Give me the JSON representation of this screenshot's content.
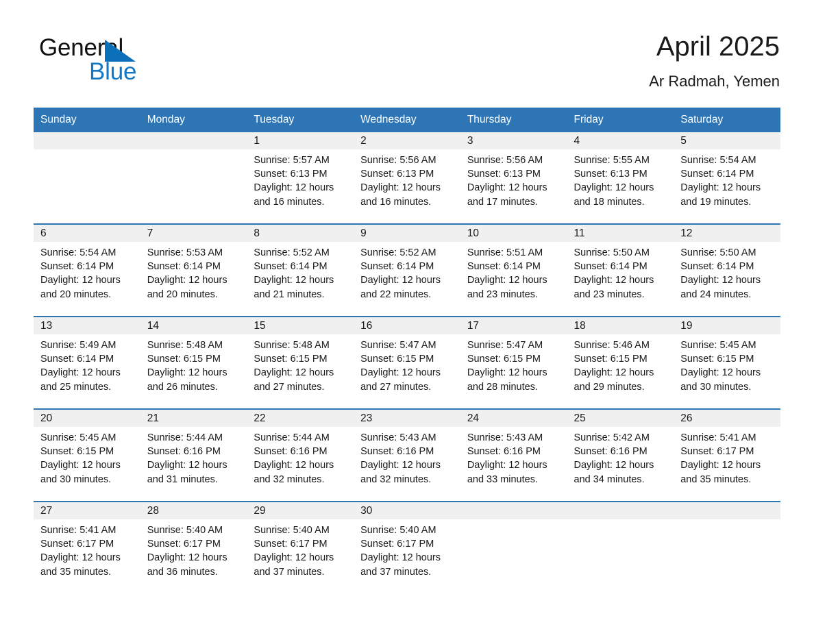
{
  "brand": {
    "word_top": "General",
    "word_bottom": "Blue",
    "triangle_color": "#0b6fba",
    "blue_color": "#1277c4"
  },
  "header": {
    "title": "April 2025",
    "subtitle": "Ar Radmah, Yemen"
  },
  "theme": {
    "header_blue": "#2e75b6",
    "daynum_band": "#f0f0f0",
    "text": "#1a1a1a"
  },
  "weekdays": [
    "Sunday",
    "Monday",
    "Tuesday",
    "Wednesday",
    "Thursday",
    "Friday",
    "Saturday"
  ],
  "labels": {
    "sunrise_prefix": "Sunrise:",
    "sunset_prefix": "Sunset:",
    "daylight_prefix": "Daylight:"
  },
  "weeks": [
    [
      {
        "day": "",
        "empty": true,
        "sunrise": "",
        "sunset": "",
        "daylight_a": "",
        "daylight_b": ""
      },
      {
        "day": "",
        "empty": true,
        "sunrise": "",
        "sunset": "",
        "daylight_a": "",
        "daylight_b": ""
      },
      {
        "day": "1",
        "empty": false,
        "sunrise": "Sunrise: 5:57 AM",
        "sunset": "Sunset: 6:13 PM",
        "daylight_a": "Daylight: 12 hours",
        "daylight_b": "and 16 minutes."
      },
      {
        "day": "2",
        "empty": false,
        "sunrise": "Sunrise: 5:56 AM",
        "sunset": "Sunset: 6:13 PM",
        "daylight_a": "Daylight: 12 hours",
        "daylight_b": "and 16 minutes."
      },
      {
        "day": "3",
        "empty": false,
        "sunrise": "Sunrise: 5:56 AM",
        "sunset": "Sunset: 6:13 PM",
        "daylight_a": "Daylight: 12 hours",
        "daylight_b": "and 17 minutes."
      },
      {
        "day": "4",
        "empty": false,
        "sunrise": "Sunrise: 5:55 AM",
        "sunset": "Sunset: 6:13 PM",
        "daylight_a": "Daylight: 12 hours",
        "daylight_b": "and 18 minutes."
      },
      {
        "day": "5",
        "empty": false,
        "sunrise": "Sunrise: 5:54 AM",
        "sunset": "Sunset: 6:14 PM",
        "daylight_a": "Daylight: 12 hours",
        "daylight_b": "and 19 minutes."
      }
    ],
    [
      {
        "day": "6",
        "empty": false,
        "sunrise": "Sunrise: 5:54 AM",
        "sunset": "Sunset: 6:14 PM",
        "daylight_a": "Daylight: 12 hours",
        "daylight_b": "and 20 minutes."
      },
      {
        "day": "7",
        "empty": false,
        "sunrise": "Sunrise: 5:53 AM",
        "sunset": "Sunset: 6:14 PM",
        "daylight_a": "Daylight: 12 hours",
        "daylight_b": "and 20 minutes."
      },
      {
        "day": "8",
        "empty": false,
        "sunrise": "Sunrise: 5:52 AM",
        "sunset": "Sunset: 6:14 PM",
        "daylight_a": "Daylight: 12 hours",
        "daylight_b": "and 21 minutes."
      },
      {
        "day": "9",
        "empty": false,
        "sunrise": "Sunrise: 5:52 AM",
        "sunset": "Sunset: 6:14 PM",
        "daylight_a": "Daylight: 12 hours",
        "daylight_b": "and 22 minutes."
      },
      {
        "day": "10",
        "empty": false,
        "sunrise": "Sunrise: 5:51 AM",
        "sunset": "Sunset: 6:14 PM",
        "daylight_a": "Daylight: 12 hours",
        "daylight_b": "and 23 minutes."
      },
      {
        "day": "11",
        "empty": false,
        "sunrise": "Sunrise: 5:50 AM",
        "sunset": "Sunset: 6:14 PM",
        "daylight_a": "Daylight: 12 hours",
        "daylight_b": "and 23 minutes."
      },
      {
        "day": "12",
        "empty": false,
        "sunrise": "Sunrise: 5:50 AM",
        "sunset": "Sunset: 6:14 PM",
        "daylight_a": "Daylight: 12 hours",
        "daylight_b": "and 24 minutes."
      }
    ],
    [
      {
        "day": "13",
        "empty": false,
        "sunrise": "Sunrise: 5:49 AM",
        "sunset": "Sunset: 6:14 PM",
        "daylight_a": "Daylight: 12 hours",
        "daylight_b": "and 25 minutes."
      },
      {
        "day": "14",
        "empty": false,
        "sunrise": "Sunrise: 5:48 AM",
        "sunset": "Sunset: 6:15 PM",
        "daylight_a": "Daylight: 12 hours",
        "daylight_b": "and 26 minutes."
      },
      {
        "day": "15",
        "empty": false,
        "sunrise": "Sunrise: 5:48 AM",
        "sunset": "Sunset: 6:15 PM",
        "daylight_a": "Daylight: 12 hours",
        "daylight_b": "and 27 minutes."
      },
      {
        "day": "16",
        "empty": false,
        "sunrise": "Sunrise: 5:47 AM",
        "sunset": "Sunset: 6:15 PM",
        "daylight_a": "Daylight: 12 hours",
        "daylight_b": "and 27 minutes."
      },
      {
        "day": "17",
        "empty": false,
        "sunrise": "Sunrise: 5:47 AM",
        "sunset": "Sunset: 6:15 PM",
        "daylight_a": "Daylight: 12 hours",
        "daylight_b": "and 28 minutes."
      },
      {
        "day": "18",
        "empty": false,
        "sunrise": "Sunrise: 5:46 AM",
        "sunset": "Sunset: 6:15 PM",
        "daylight_a": "Daylight: 12 hours",
        "daylight_b": "and 29 minutes."
      },
      {
        "day": "19",
        "empty": false,
        "sunrise": "Sunrise: 5:45 AM",
        "sunset": "Sunset: 6:15 PM",
        "daylight_a": "Daylight: 12 hours",
        "daylight_b": "and 30 minutes."
      }
    ],
    [
      {
        "day": "20",
        "empty": false,
        "sunrise": "Sunrise: 5:45 AM",
        "sunset": "Sunset: 6:15 PM",
        "daylight_a": "Daylight: 12 hours",
        "daylight_b": "and 30 minutes."
      },
      {
        "day": "21",
        "empty": false,
        "sunrise": "Sunrise: 5:44 AM",
        "sunset": "Sunset: 6:16 PM",
        "daylight_a": "Daylight: 12 hours",
        "daylight_b": "and 31 minutes."
      },
      {
        "day": "22",
        "empty": false,
        "sunrise": "Sunrise: 5:44 AM",
        "sunset": "Sunset: 6:16 PM",
        "daylight_a": "Daylight: 12 hours",
        "daylight_b": "and 32 minutes."
      },
      {
        "day": "23",
        "empty": false,
        "sunrise": "Sunrise: 5:43 AM",
        "sunset": "Sunset: 6:16 PM",
        "daylight_a": "Daylight: 12 hours",
        "daylight_b": "and 32 minutes."
      },
      {
        "day": "24",
        "empty": false,
        "sunrise": "Sunrise: 5:43 AM",
        "sunset": "Sunset: 6:16 PM",
        "daylight_a": "Daylight: 12 hours",
        "daylight_b": "and 33 minutes."
      },
      {
        "day": "25",
        "empty": false,
        "sunrise": "Sunrise: 5:42 AM",
        "sunset": "Sunset: 6:16 PM",
        "daylight_a": "Daylight: 12 hours",
        "daylight_b": "and 34 minutes."
      },
      {
        "day": "26",
        "empty": false,
        "sunrise": "Sunrise: 5:41 AM",
        "sunset": "Sunset: 6:17 PM",
        "daylight_a": "Daylight: 12 hours",
        "daylight_b": "and 35 minutes."
      }
    ],
    [
      {
        "day": "27",
        "empty": false,
        "sunrise": "Sunrise: 5:41 AM",
        "sunset": "Sunset: 6:17 PM",
        "daylight_a": "Daylight: 12 hours",
        "daylight_b": "and 35 minutes."
      },
      {
        "day": "28",
        "empty": false,
        "sunrise": "Sunrise: 5:40 AM",
        "sunset": "Sunset: 6:17 PM",
        "daylight_a": "Daylight: 12 hours",
        "daylight_b": "and 36 minutes."
      },
      {
        "day": "29",
        "empty": false,
        "sunrise": "Sunrise: 5:40 AM",
        "sunset": "Sunset: 6:17 PM",
        "daylight_a": "Daylight: 12 hours",
        "daylight_b": "and 37 minutes."
      },
      {
        "day": "30",
        "empty": false,
        "sunrise": "Sunrise: 5:40 AM",
        "sunset": "Sunset: 6:17 PM",
        "daylight_a": "Daylight: 12 hours",
        "daylight_b": "and 37 minutes."
      },
      {
        "day": "",
        "empty": true,
        "sunrise": "",
        "sunset": "",
        "daylight_a": "",
        "daylight_b": ""
      },
      {
        "day": "",
        "empty": true,
        "sunrise": "",
        "sunset": "",
        "daylight_a": "",
        "daylight_b": ""
      },
      {
        "day": "",
        "empty": true,
        "sunrise": "",
        "sunset": "",
        "daylight_a": "",
        "daylight_b": ""
      }
    ]
  ]
}
